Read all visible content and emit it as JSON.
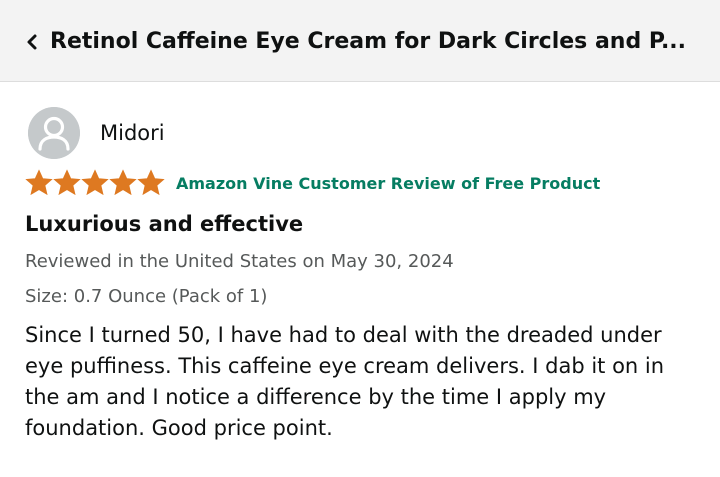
{
  "header": {
    "title": "Retinol Caffeine Eye Cream for Dark Circles and P...",
    "back_icon": "chevron-left-icon"
  },
  "review": {
    "reviewer_name": "Midori",
    "avatar_icon": "user-avatar-icon",
    "rating": 5,
    "rating_max": 5,
    "star_color": "#de7921",
    "badge": "Amazon Vine Customer Review of Free Product",
    "badge_color": "#067d62",
    "title": "Luxurious and effective",
    "date_line": "Reviewed in the United States on May 30, 2024",
    "size_line": "Size: 0.7 Ounce (Pack of 1)",
    "body": "Since I turned 50, I have had to deal with the dreaded under eye puffiness. This caffeine eye cream delivers. I dab it on in the am and I notice a difference by the time I apply my foundation. Good price point."
  }
}
